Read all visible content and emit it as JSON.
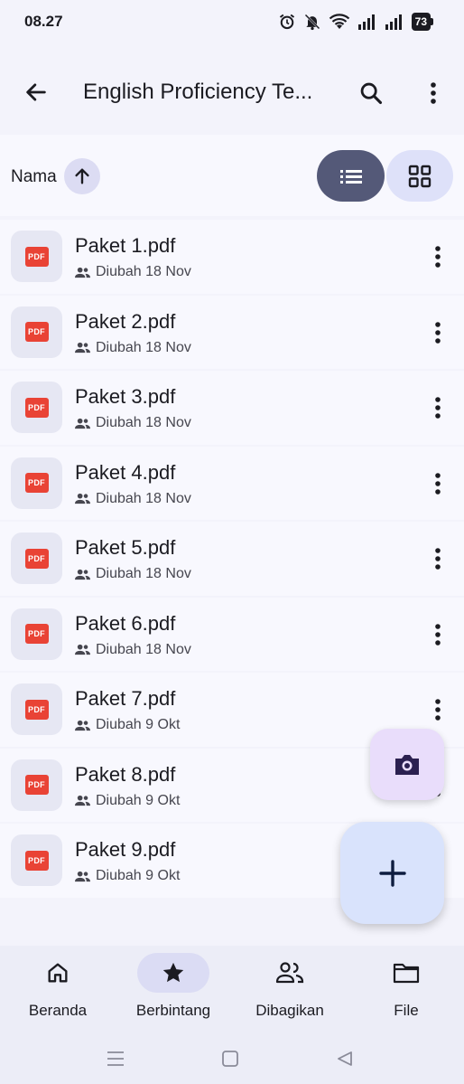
{
  "status_bar": {
    "time": "08.27",
    "battery": "73"
  },
  "app_bar": {
    "title": "English Proficiency Te..."
  },
  "sort": {
    "label": "Nama"
  },
  "files": [
    {
      "name": "Paket 1.pdf",
      "modified": "Diubah 18 Nov",
      "badge": "PDF"
    },
    {
      "name": "Paket 2.pdf",
      "modified": "Diubah 18 Nov",
      "badge": "PDF"
    },
    {
      "name": "Paket 3.pdf",
      "modified": "Diubah 18 Nov",
      "badge": "PDF"
    },
    {
      "name": "Paket 4.pdf",
      "modified": "Diubah 18 Nov",
      "badge": "PDF"
    },
    {
      "name": "Paket 5.pdf",
      "modified": "Diubah 18 Nov",
      "badge": "PDF"
    },
    {
      "name": "Paket 6.pdf",
      "modified": "Diubah 18 Nov",
      "badge": "PDF"
    },
    {
      "name": "Paket 7.pdf",
      "modified": "Diubah 9 Okt",
      "badge": "PDF"
    },
    {
      "name": "Paket 8.pdf",
      "modified": "Diubah 9 Okt",
      "badge": "PDF"
    },
    {
      "name": "Paket 9.pdf",
      "modified": "Diubah 9 Okt",
      "badge": "PDF"
    }
  ],
  "bottom_nav": {
    "items": [
      {
        "label": "Beranda",
        "icon": "home-icon"
      },
      {
        "label": "Berbintang",
        "icon": "star-icon",
        "active": true
      },
      {
        "label": "Dibagikan",
        "icon": "people-icon"
      },
      {
        "label": "File",
        "icon": "folder-icon"
      }
    ]
  },
  "colors": {
    "accent_dark": "#545978",
    "pdf_red": "#e94335",
    "fab_camera": "#e9ddfb",
    "fab_new": "#d9e3fc"
  }
}
